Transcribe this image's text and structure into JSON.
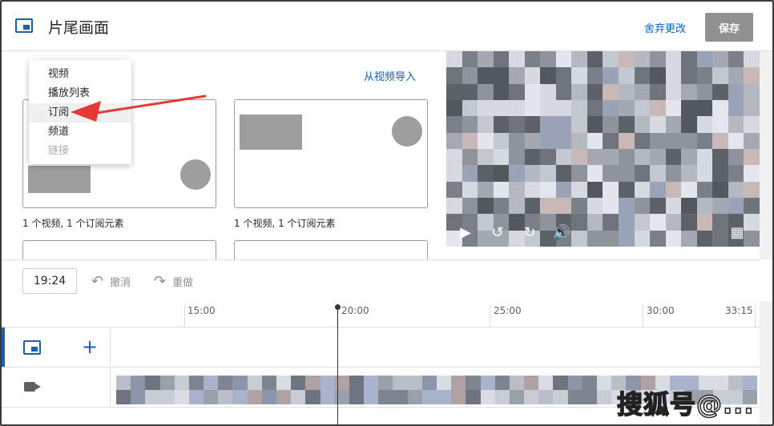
{
  "header": {
    "title": "片尾画面",
    "discard_label": "舍弃更改",
    "save_label": "保存"
  },
  "left_panel": {
    "import_link": "从视频导入",
    "dropdown": {
      "items": [
        {
          "label": "视频"
        },
        {
          "label": "播放列表"
        },
        {
          "label": "订阅"
        },
        {
          "label": "频道"
        },
        {
          "label": "链接"
        }
      ]
    },
    "templates": [
      {
        "caption": "1 个视频, 1 个订阅元素"
      },
      {
        "caption": "1 个视频, 1 个订阅元素"
      }
    ]
  },
  "preview": {
    "controls": [
      {
        "icon": "play-icon"
      },
      {
        "icon": "rewind-10-icon"
      },
      {
        "icon": "forward-10-icon"
      },
      {
        "icon": "volume-icon"
      },
      {
        "icon": "grid-icon"
      }
    ]
  },
  "toolbar": {
    "current_time": "19:24",
    "undo_label": "撤消",
    "redo_label": "重做"
  },
  "timeline": {
    "ticks": [
      "15:00",
      "20:00",
      "25:00",
      "30:00",
      "33:15"
    ]
  },
  "watermark": "搜狐号@..."
}
